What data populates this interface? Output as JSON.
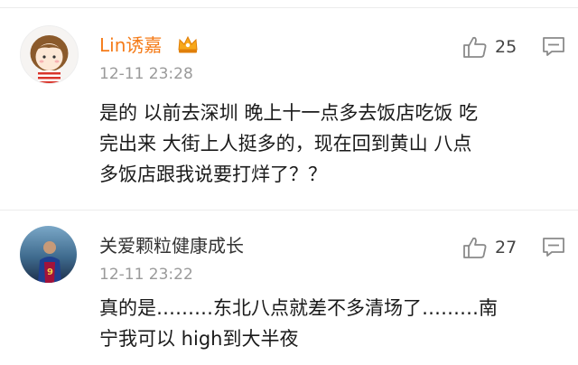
{
  "comments": [
    {
      "username": "Lin诱嘉",
      "username_color": "#f57c1a",
      "badge_icon": "crown-vip-badge-icon",
      "timestamp": "12-11 23:28",
      "likes": "25",
      "text": "是的 以前去深圳 晚上十一点多去饭店吃饭 吃\n完出来 大街上人挺多的，现在回到黄山 八点\n多饭店跟我说要打烊了？？"
    },
    {
      "username": "关爱颗粒健康成长",
      "username_color": "#333333",
      "timestamp": "12-11 23:22",
      "likes": "27",
      "text": "真的是………东北八点就差不多清场了………南\n宁我可以 high到大半夜"
    }
  ],
  "icons": {
    "like": "thumbs-up-icon",
    "reply": "comment-bubble-icon"
  }
}
